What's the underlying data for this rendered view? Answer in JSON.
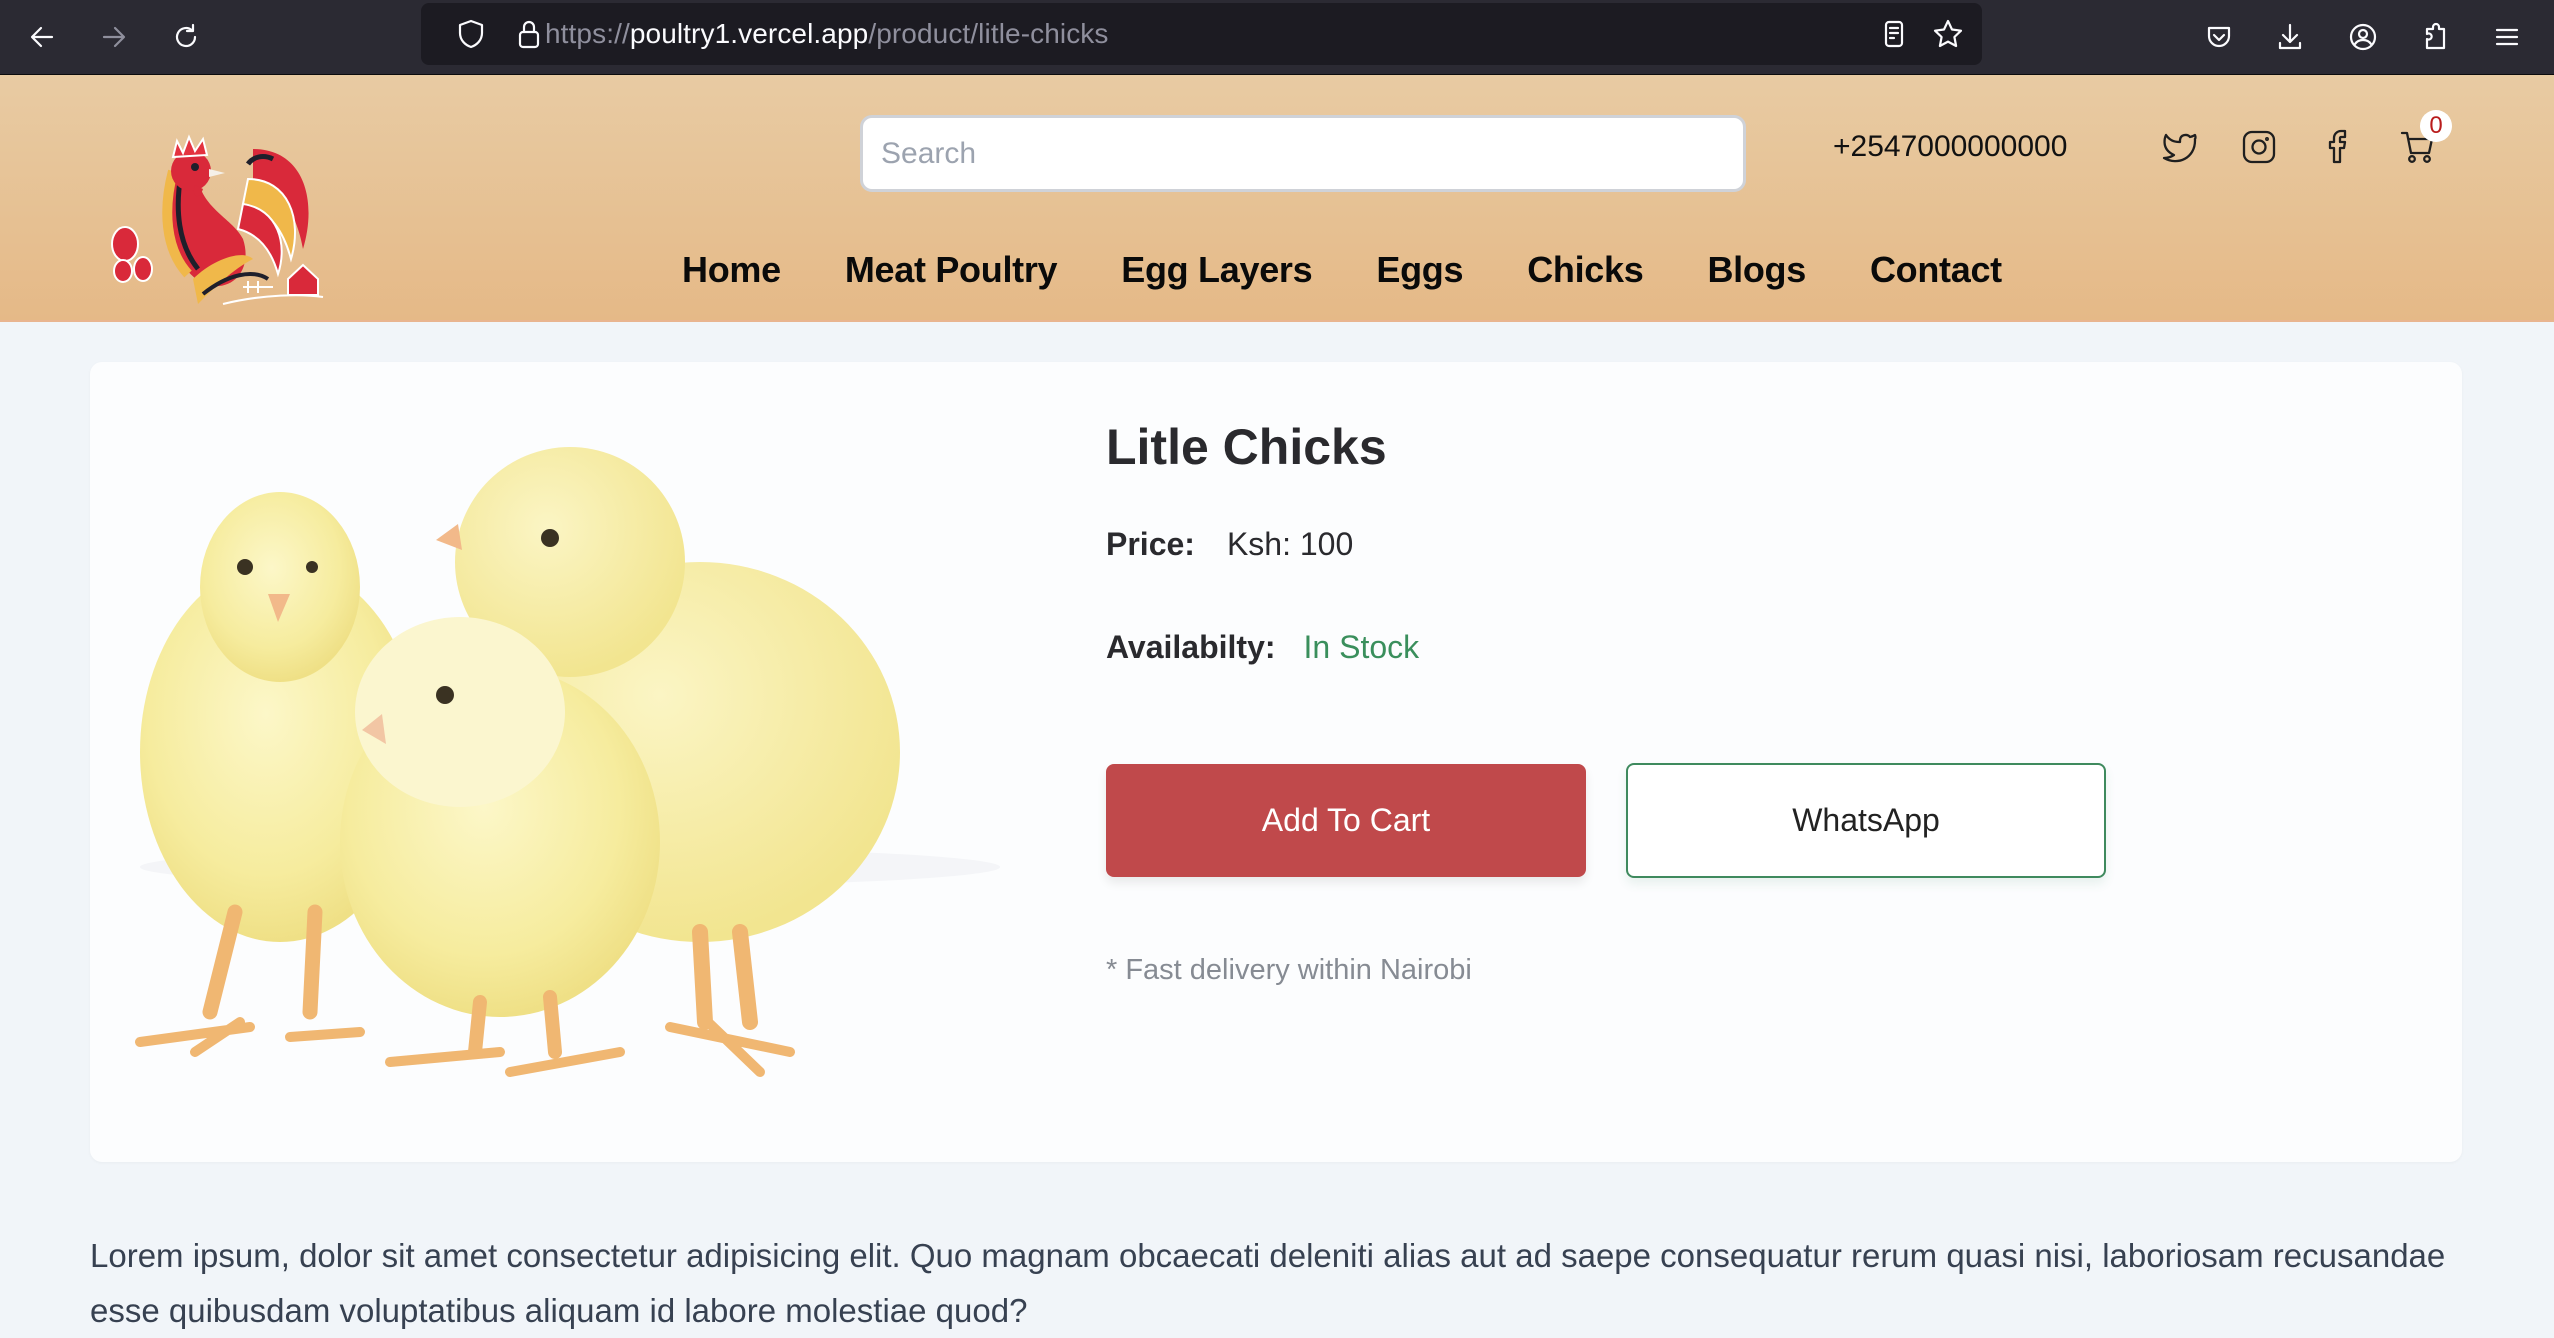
{
  "browser": {
    "url_scheme": "https://",
    "url_domain": "poultry1.vercel.app",
    "url_path": "/product/litle-chicks",
    "icons": [
      "back-icon",
      "forward-icon",
      "reload-icon",
      "shield-icon",
      "lock-icon",
      "reader-view-icon",
      "bookmark-star-icon",
      "pocket-icon",
      "download-icon",
      "account-icon",
      "extensions-icon",
      "menu-icon"
    ]
  },
  "header": {
    "logo_alt": "Rooster farm logo",
    "search_placeholder": "Search",
    "search_value": "",
    "phone": "+2547000000000",
    "social_icons": [
      "twitter-icon",
      "instagram-icon",
      "facebook-icon"
    ],
    "cart_count": "0",
    "nav": [
      {
        "label": "Home"
      },
      {
        "label": "Meat Poultry"
      },
      {
        "label": "Egg Layers"
      },
      {
        "label": "Eggs"
      },
      {
        "label": "Chicks"
      },
      {
        "label": "Blogs"
      },
      {
        "label": "Contact"
      }
    ]
  },
  "product": {
    "image_alt": "Three yellow chicks",
    "title": "Litle Chicks",
    "price_label": "Price:",
    "price_value": "Ksh: 100",
    "availability_label": "Availabilty:",
    "availability_value": "In Stock",
    "add_to_cart_label": "Add To Cart",
    "whatsapp_label": "WhatsApp",
    "delivery_note": "* Fast delivery within Nairobi"
  },
  "description": "Lorem ipsum, dolor sit amet consectetur adipisicing elit. Quo magnam obcaecati deleniti alias aut ad saepe consequatur rerum quasi nisi, laboriosam recusandae esse quibusdam voluptatibus aliquam id labore molestiae quod?",
  "colors": {
    "primary_red": "#c0494b",
    "stock_green": "#3a8f5c",
    "header_top": "#e8cba3",
    "header_bottom": "#e5b987",
    "page_bg": "#f1f5f9",
    "cart_badge_text": "#b91c1c"
  }
}
